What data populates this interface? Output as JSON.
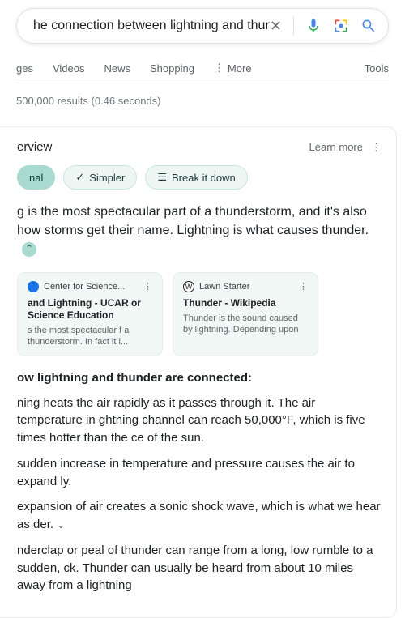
{
  "search": {
    "query": "he connection between lightning and thunder"
  },
  "tabs": {
    "images": "ges",
    "videos": "Videos",
    "news": "News",
    "shopping": "Shopping",
    "more": "More",
    "tools": "Tools"
  },
  "stats": "500,000 results (0.46 seconds)",
  "ai": {
    "title": "erview",
    "learn_more": "Learn more",
    "chips": {
      "original": "nal",
      "simpler": "Simpler",
      "breakdown": "Break it down"
    },
    "summary": "g is the most spectacular part of a thunderstorm, and it's also how storms get their name. Lightning is what causes thunder.",
    "subhead": "ow lightning and thunder are connected:",
    "bullets": {
      "b1": "ning heats the air rapidly as it passes through it. The air temperature in ghtning channel can reach 50,000°F, which is five times hotter than the ce of the sun.",
      "b2": "sudden increase in temperature and pressure causes the air to expand ly.",
      "b3": "expansion of air creates a sonic shock wave, which is what we hear as der.",
      "b4": "nderclap or peal of thunder can range from a long, low rumble to a sudden, ck. Thunder can usually be heard from about 10 miles away from a lightning"
    },
    "sources": [
      {
        "site": "Center for Science...",
        "title": "and Lightning - UCAR or Science Education",
        "snippet": "s the most spectacular f a thunderstorm. In fact it i..."
      },
      {
        "site": "Lawn Starter",
        "title": "Thunder - Wikipedia",
        "snippet": "Thunder is the sound caused by lightning. Depending upon the..."
      }
    ]
  }
}
